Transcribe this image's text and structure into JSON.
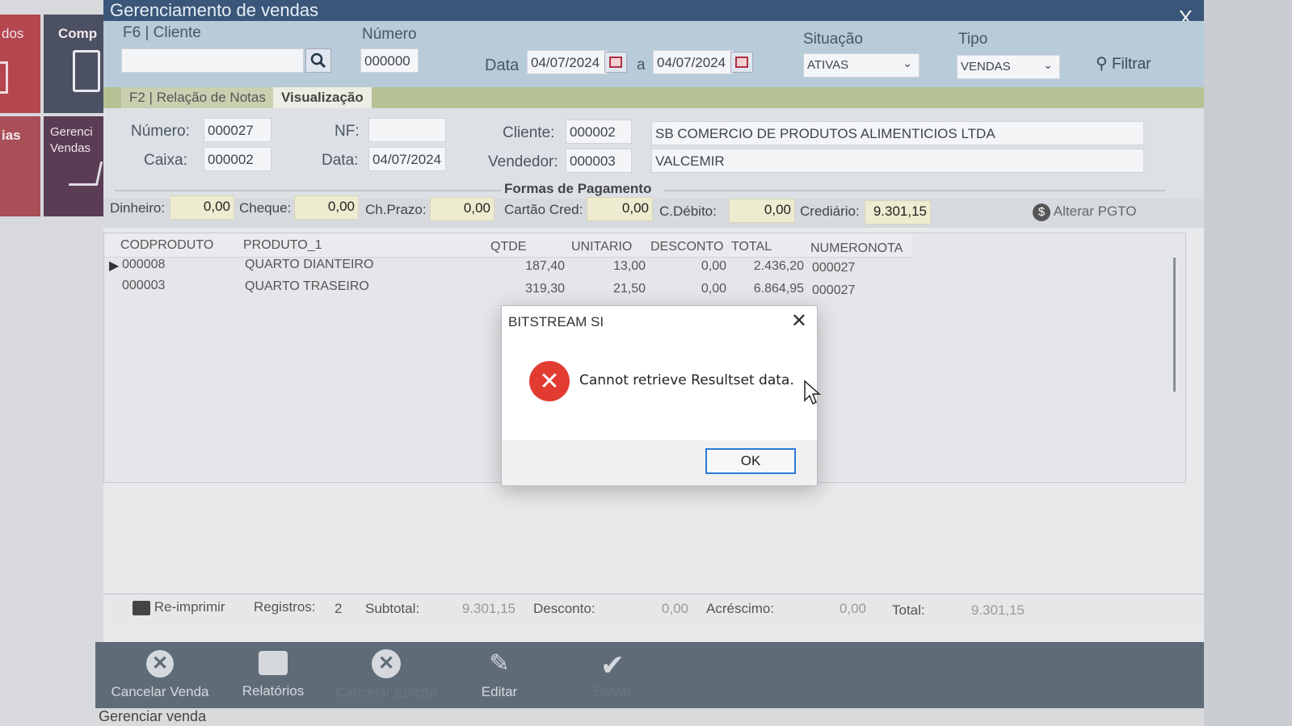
{
  "bg_app": {
    "tile_labels": [
      "dos",
      "Comp",
      "ias",
      "Gerenci Vendas"
    ]
  },
  "window": {
    "title": "Gerenciamento de vendas",
    "close": "X"
  },
  "filter": {
    "cliente_label": "F6 | Cliente",
    "cliente_value": "",
    "numero_label": "Número",
    "numero_value": "000000",
    "data_label": "Data",
    "date_from": "04/07/2024",
    "date_sep": "a",
    "date_to": "04/07/2024",
    "situacao_label": "Situação",
    "situacao_value": "ATIVAS",
    "tipo_label": "Tipo",
    "tipo_value": "VENDAS",
    "filtrar": "Filtrar"
  },
  "tabs": [
    {
      "label": "F2 | Relação de Notas"
    },
    {
      "label": "Visualização"
    }
  ],
  "details": {
    "numero_label": "Número:",
    "numero_value": "000027",
    "nf_label": "NF:",
    "nf_value": "",
    "cliente_label": "Cliente:",
    "cliente_code": "000002",
    "cliente_name": "SB COMERCIO DE PRODUTOS ALIMENTICIOS LTDA",
    "caixa_label": "Caixa:",
    "caixa_value": "000002",
    "data_label": "Data:",
    "data_value": "04/07/2024",
    "vendedor_label": "Vendedor:",
    "vendedor_code": "000003",
    "vendedor_name": "VALCEMIR"
  },
  "payments": {
    "title": "Formas de Pagamento",
    "dinheiro_label": "Dinheiro:",
    "dinheiro": "0,00",
    "cheque_label": "Cheque:",
    "cheque": "0,00",
    "chprazo_label": "Ch.Prazo:",
    "chprazo": "0,00",
    "cartao_label": "Cartão Cred:",
    "cartao": "0,00",
    "cdebito_label": "C.Débito:",
    "cdebito": "0,00",
    "crediario_label": "Crediário:",
    "crediario": "9.301,15",
    "alterar": "Alterar PGTO"
  },
  "grid": {
    "headers": [
      "CODPRODUTO",
      "PRODUTO_1",
      "QTDE",
      "UNITARIO",
      "DESCONTO",
      "TOTAL",
      "NUMERONOTA"
    ],
    "rows": [
      [
        "000008",
        "QUARTO DIANTEIRO",
        "187,40",
        "13,00",
        "0,00",
        "2.436,20",
        "000027"
      ],
      [
        "000003",
        "QUARTO TRASEIRO",
        "319,30",
        "21,50",
        "0,00",
        "6.864,95",
        "000027"
      ]
    ]
  },
  "footer": {
    "reimprimir": "Re-imprimir",
    "registros_label": "Registros:",
    "registros": "2",
    "subtotal_label": "Subtotal:",
    "subtotal": "9.301,15",
    "desconto_label": "Desconto:",
    "desconto": "0,00",
    "acrescimo_label": "Acréscimo:",
    "acrescimo": "0,00",
    "total_label": "Total:",
    "total": "9.301,15"
  },
  "toolbar": {
    "cancelar_venda": "Cancelar Venda",
    "relatorios": "Relatórios",
    "cancelar_edicao": "Cancelar Edição",
    "editar": "Editar",
    "salvar": "Salvar"
  },
  "status": "Gerenciar venda",
  "dialog": {
    "title": "BITSTREAM SI",
    "close": "✕",
    "message": "Cannot retrieve Resultset data.",
    "ok": "OK"
  },
  "colors": {
    "titlebar": "#3a5779",
    "header": "#b7cbd9",
    "tabbar": "#b7c294",
    "toolbar": "#5f6c78",
    "error": "#e23b32"
  }
}
